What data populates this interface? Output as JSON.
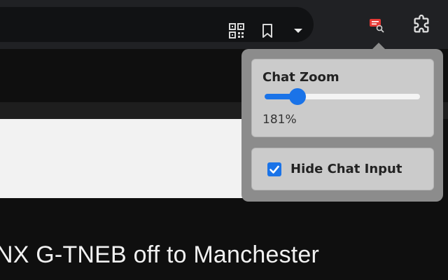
{
  "browser": {
    "toolbar_icons": [
      "qr-code-icon",
      "bookmark-icon",
      "dropdown-caret-icon",
      "chat-extension-icon",
      "puzzle-extensions-icon"
    ]
  },
  "page": {
    "title_text": "NX G-TNEB off to Manchester"
  },
  "popup": {
    "zoom": {
      "title": "Chat Zoom",
      "value": 181,
      "value_label": "181%",
      "slider_fraction": 0.21
    },
    "hide_input": {
      "label": "Hide Chat Input",
      "checked": true
    }
  },
  "colors": {
    "accent": "#1a73e8",
    "popup_bg": "#8c8c8c",
    "card_bg": "#cbcbcb",
    "extension_icon": "#e53935"
  }
}
